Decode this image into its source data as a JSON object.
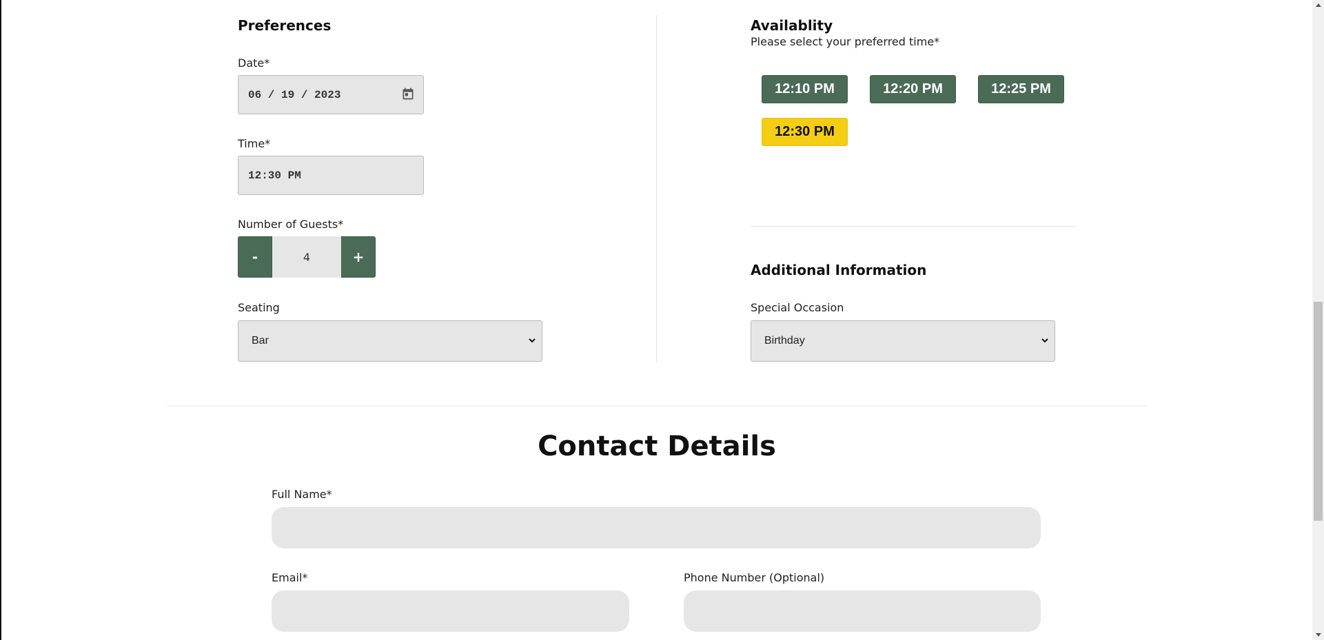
{
  "preferences": {
    "title": "Preferences",
    "date_label": "Date*",
    "date_value": "06 / 19 / 2023",
    "time_label": "Time*",
    "time_value": "12:30 PM",
    "guests_label": "Number of Guests*",
    "guests_minus": "-",
    "guests_value": "4",
    "guests_plus": "+",
    "seating_label": "Seating",
    "seating_value": "Bar"
  },
  "availability": {
    "title": "Availablity",
    "subtitle": "Please select your preferred time*",
    "times": [
      "12:10 PM",
      "12:20 PM",
      "12:25 PM",
      "12:30 PM"
    ],
    "selected_time": "12:30 PM"
  },
  "additional": {
    "title": "Additional Information",
    "occasion_label": "Special Occasion",
    "occasion_value": "Birthday"
  },
  "contact": {
    "title": "Contact Details",
    "full_name_label": "Full Name*",
    "full_name_value": "",
    "email_label": "Email*",
    "email_value": "",
    "phone_label": "Phone Number (Optional)",
    "phone_value": ""
  },
  "colors": {
    "accent_green": "#4a6b55",
    "selected_yellow": "#f4ce14",
    "field_bg": "#e6e6e6"
  },
  "icons": {
    "calendar": "calendar-icon",
    "chevron": "chevron-down-icon"
  }
}
